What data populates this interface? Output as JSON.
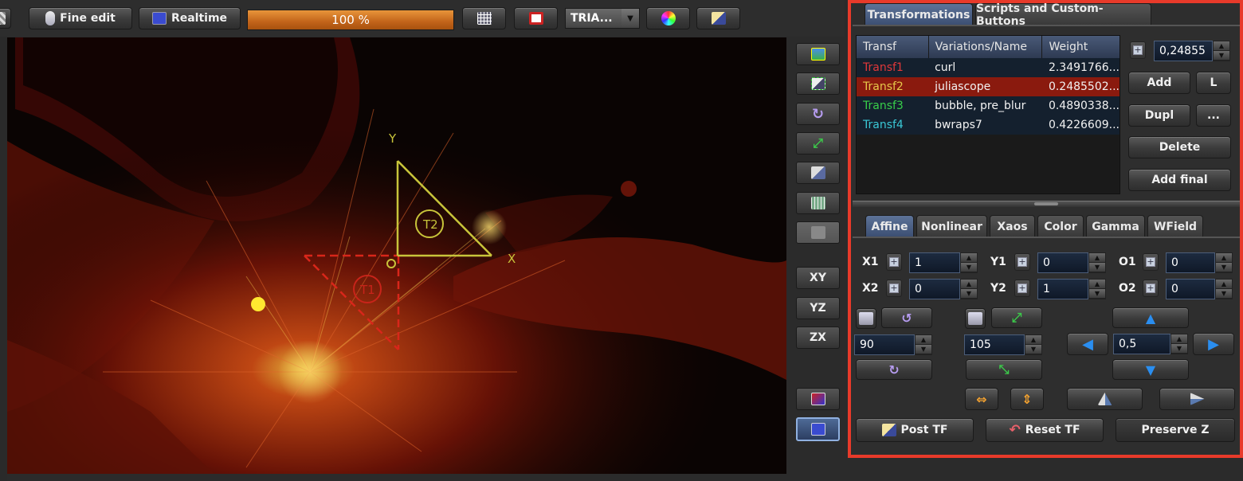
{
  "toolbar": {
    "fine_edit_label": "Fine edit",
    "realtime_label": "Realtime",
    "progress_label": "100 %",
    "progress_value": 1.0,
    "triangle_select_value": "TRIA..."
  },
  "canvas": {
    "x_axis_label": "X",
    "y_axis_label": "Y",
    "t1_label": "T1",
    "t2_label": "T2"
  },
  "side_toolbar": {
    "xy_label": "XY",
    "yz_label": "YZ",
    "zx_label": "ZX"
  },
  "right_panel": {
    "tabs": [
      "Transformations",
      "Scripts and Custom-Buttons"
    ],
    "table": {
      "headers": [
        "Transf",
        "Variations/Name",
        "Weight"
      ],
      "rows": [
        {
          "transf": "Transf1",
          "name": "curl",
          "weight": "2.3491766...",
          "color": "#e0383a"
        },
        {
          "transf": "Transf2",
          "name": "juliascope",
          "weight": "0.2485502...",
          "color": "#e6c84a"
        },
        {
          "transf": "Transf3",
          "name": "bubble, pre_blur",
          "weight": "0.4890338...",
          "color": "#38d04a"
        },
        {
          "transf": "Transf4",
          "name": "bwraps7",
          "weight": "0.4226609...",
          "color": "#3ac8d6"
        }
      ]
    },
    "weight_value": "0,24855",
    "add_label": "Add",
    "l_label": "L",
    "dupl_label": "Dupl",
    "more_label": "...",
    "delete_label": "Delete",
    "add_final_label": "Add final",
    "sub_tabs": [
      "Affine",
      "Nonlinear",
      "Xaos",
      "Color",
      "Gamma",
      "WField"
    ],
    "affine": {
      "x1_label": "X1",
      "x1_value": "1",
      "x2_label": "X2",
      "x2_value": "0",
      "y1_label": "Y1",
      "y1_value": "0",
      "y2_label": "Y2",
      "y2_value": "1",
      "o1_label": "O1",
      "o1_value": "0",
      "o2_label": "O2",
      "o2_value": "0",
      "rotate_value": "90",
      "scale_value": "105",
      "move_value": "0,5"
    },
    "post_tf_label": "Post TF",
    "reset_tf_label": "Reset TF",
    "preserve_z_label": "Preserve Z"
  },
  "colors": {
    "highlight_border": "#e83a2a",
    "selected_row": "#8a1a0e",
    "progress_fill": "#d77a1e",
    "arrow_blue": "#2a8ef0"
  }
}
